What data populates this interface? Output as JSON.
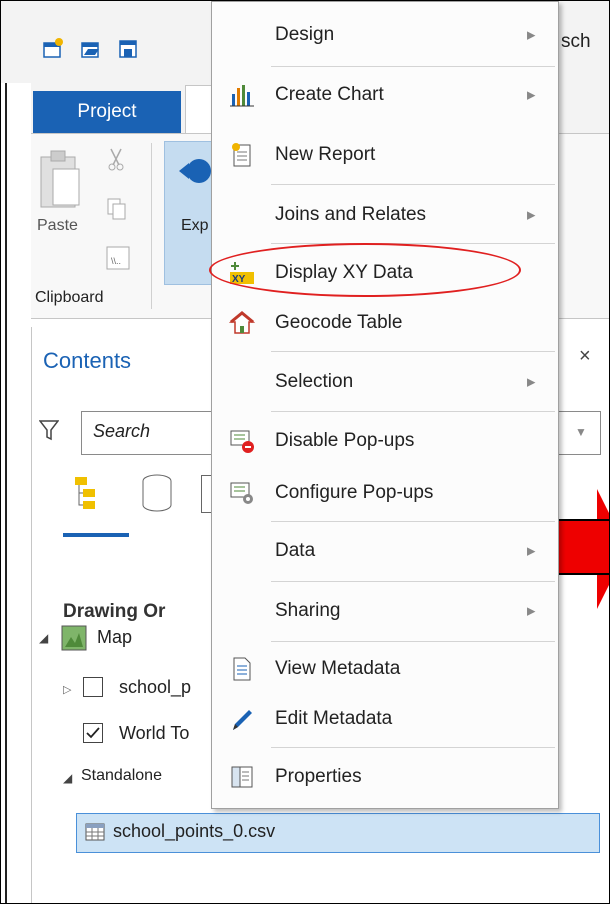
{
  "ribbon": {
    "tab_project": "Project",
    "file_name_partial": "sch",
    "paste_label": "Paste",
    "explore_label_partial": "Exp",
    "clipboard_group": "Clipboard"
  },
  "contents_pane": {
    "title": "Contents",
    "close_icon": "×",
    "search_placeholder": "Search",
    "drawing_order_partial": "Drawing Or",
    "map_label": "Map",
    "layer1_partial": "school_p",
    "layer2_partial": "World To",
    "standalone_partial": "Standalone",
    "csv_table": "school_points_0.csv"
  },
  "context_menu": {
    "items": [
      {
        "label": "Design",
        "submenu": true,
        "icon": "none"
      },
      {
        "label": "Create Chart",
        "submenu": true,
        "icon": "bar-chart-icon"
      },
      {
        "label": "New Report",
        "submenu": false,
        "icon": "report-icon"
      },
      {
        "label": "Joins and Relates",
        "submenu": true,
        "icon": "none"
      },
      {
        "label": "Display XY Data",
        "submenu": false,
        "icon": "xy-data-icon"
      },
      {
        "label": "Geocode Table",
        "submenu": false,
        "icon": "geocode-icon"
      },
      {
        "label": "Selection",
        "submenu": true,
        "icon": "none"
      },
      {
        "label": "Disable Pop-ups",
        "submenu": false,
        "icon": "disable-popups-icon"
      },
      {
        "label": "Configure Pop-ups",
        "submenu": false,
        "icon": "configure-popups-icon"
      },
      {
        "label": "Data",
        "submenu": true,
        "icon": "none"
      },
      {
        "label": "Sharing",
        "submenu": true,
        "icon": "none"
      },
      {
        "label": "View Metadata",
        "submenu": false,
        "icon": "view-metadata-icon"
      },
      {
        "label": "Edit Metadata",
        "submenu": false,
        "icon": "edit-metadata-icon"
      },
      {
        "label": "Properties",
        "submenu": false,
        "icon": "properties-icon"
      }
    ],
    "submenu_arrow": "▶"
  },
  "colors": {
    "accent": "#1a62b4",
    "highlight_ellipse": "#e02020",
    "annotation_arrow": "#ee0000",
    "selected_row": "#cde3f5"
  }
}
